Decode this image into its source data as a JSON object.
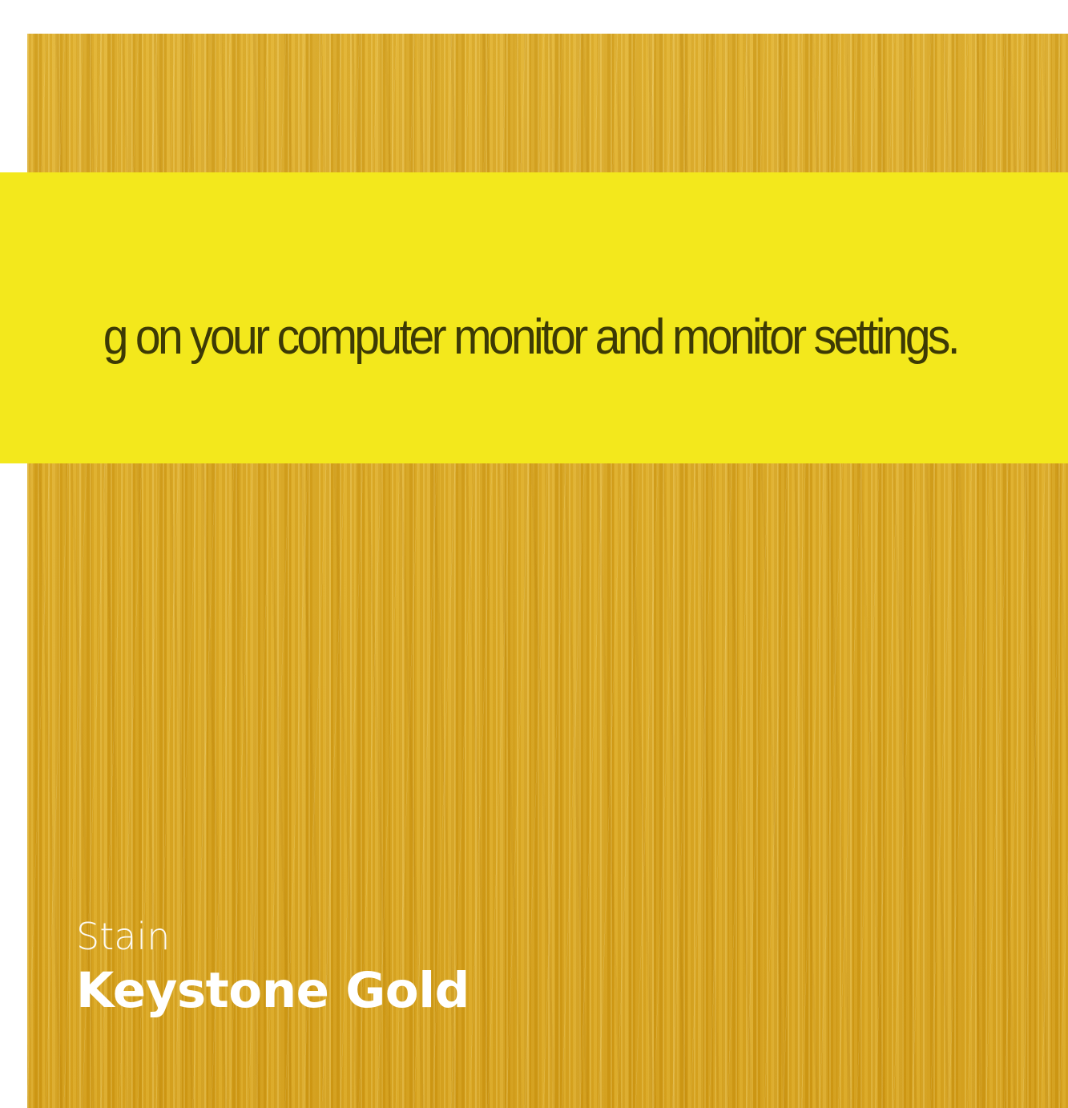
{
  "notice": {
    "text": "g on your computer monitor and monitor settings."
  },
  "swatch": {
    "label": "Stain",
    "name": "Keystone Gold"
  },
  "colors": {
    "swatch_base": "#d9a61f",
    "notice_band": "#f3e81c",
    "notice_text": "#3d3a05",
    "caption_text": "#ffffff"
  }
}
